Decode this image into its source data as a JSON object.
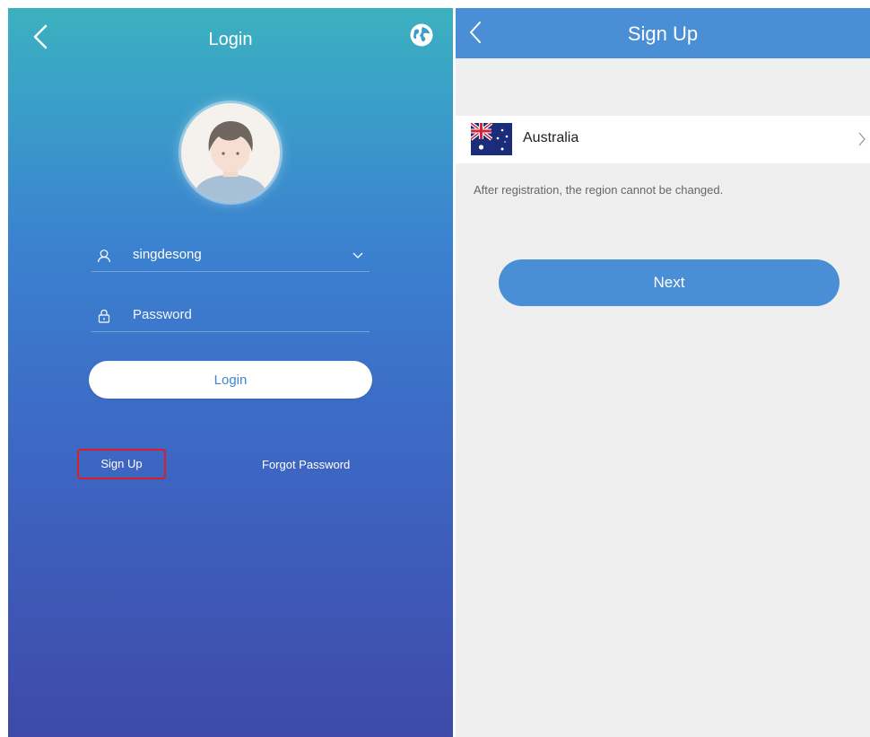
{
  "login": {
    "title": "Login",
    "username_value": "singdesong",
    "password_placeholder": "Password",
    "login_button": "Login",
    "signup_link": "Sign Up",
    "forgot_link": "Forgot Password"
  },
  "signup": {
    "title": "Sign Up",
    "region": "Australia",
    "note": "After registration, the region cannot be changed.",
    "next_button": "Next"
  },
  "icons": {
    "back": "chevron-left-icon",
    "globe": "globe-icon",
    "user": "user-icon",
    "lock": "lock-icon",
    "dropdown": "chevron-down-icon",
    "region_chevron": "chevron-right-icon",
    "flag": "australia-flag-icon"
  },
  "colors": {
    "header_blue": "#4a8fd6",
    "login_gradient_top": "#3bb1be",
    "login_gradient_bottom": "#3e49a9",
    "highlight_red": "#d61f27"
  }
}
